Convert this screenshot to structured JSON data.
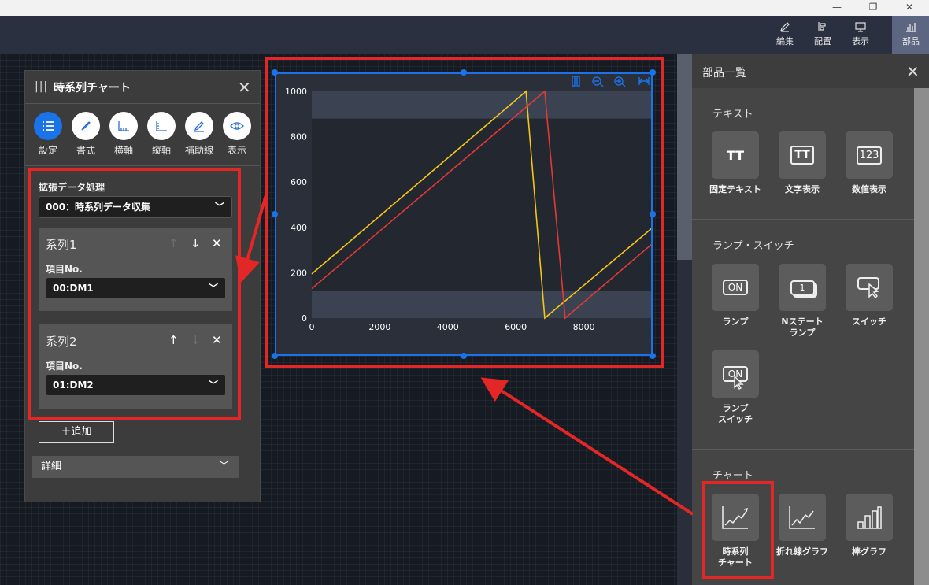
{
  "window": {
    "minimize": "—",
    "restore": "❐",
    "close": "✕"
  },
  "toolbar": {
    "items": [
      {
        "label": "編集",
        "icon": "pencil-icon"
      },
      {
        "label": "配置",
        "icon": "align-icon"
      },
      {
        "label": "表示",
        "icon": "monitor-icon"
      },
      {
        "label": "部品",
        "icon": "parts-chart-icon",
        "active": true
      }
    ]
  },
  "prop_panel": {
    "title": "時系列チャート",
    "drag_glyph": "|||",
    "close": "✕",
    "tabs": [
      {
        "label": "設定",
        "icon": "list-icon",
        "active": true
      },
      {
        "label": "書式",
        "icon": "brush-icon"
      },
      {
        "label": "横軸",
        "icon": "x-axis-icon"
      },
      {
        "label": "縦軸",
        "icon": "y-axis-icon"
      },
      {
        "label": "補助線",
        "icon": "guide-line-icon"
      },
      {
        "label": "表示",
        "icon": "eye-icon"
      }
    ],
    "ext_label": "拡張データ処理",
    "ext_select": "000：時系列データ収集",
    "series": [
      {
        "title": "系列1",
        "item_label": "項目No.",
        "item_value": "00:DM1",
        "up_enabled": false,
        "down_enabled": true
      },
      {
        "title": "系列2",
        "item_label": "項目No.",
        "item_value": "01:DM2",
        "up_enabled": true,
        "down_enabled": false
      }
    ],
    "add_button": "＋追加",
    "detail": "詳細"
  },
  "chart_data": {
    "type": "line",
    "x_ticks": [
      "0",
      "2000",
      "4000",
      "6000",
      "8000"
    ],
    "y_ticks": [
      "0",
      "200",
      "400",
      "600",
      "800",
      "1000"
    ],
    "xlim": [
      0,
      10000
    ],
    "ylim": [
      0,
      1000
    ],
    "bands": [
      {
        "from": 0,
        "to": 120,
        "color": "#3b4252"
      },
      {
        "from": 880,
        "to": 1000,
        "color": "#3b4252"
      }
    ],
    "series": [
      {
        "color": "#f5c518",
        "x": [
          0,
          6300,
          6850,
          9990
        ],
        "y": [
          195,
          1000,
          0,
          395
        ]
      },
      {
        "color": "#e53935",
        "x": [
          0,
          6850,
          7450,
          9990
        ],
        "y": [
          130,
          1000,
          0,
          325
        ]
      }
    ],
    "colors": {
      "background": "#2a2f3a",
      "plot": "#23272f",
      "axis_text": "#ffffff"
    }
  },
  "parts_panel": {
    "title": "部品一覧",
    "close": "✕",
    "groups": [
      {
        "name": "テキスト",
        "items": [
          {
            "label": "固定テキスト",
            "glyph": "TT",
            "icon": "fixed-text-icon"
          },
          {
            "label": "文字表示",
            "glyph": "TT",
            "icon": "text-display-icon"
          },
          {
            "label": "数値表示",
            "glyph": "123",
            "icon": "number-display-icon"
          }
        ]
      },
      {
        "name": "ランプ・スイッチ",
        "items": [
          {
            "label": "ランプ",
            "glyph": "ON",
            "icon": "lamp-icon"
          },
          {
            "label": "Nステート\nランプ",
            "glyph": "1",
            "icon": "n-state-lamp-icon"
          },
          {
            "label": "スイッチ",
            "glyph": "",
            "icon": "switch-icon"
          },
          {
            "label": "ランプ\nスイッチ",
            "glyph": "ON",
            "icon": "lamp-switch-icon"
          }
        ]
      },
      {
        "name": "チャート",
        "items": [
          {
            "label": "時系列\nチャート",
            "glyph": "",
            "icon": "time-series-chart-icon"
          },
          {
            "label": "折れ線グラフ",
            "glyph": "",
            "icon": "line-graph-icon"
          },
          {
            "label": "棒グラフ",
            "glyph": "",
            "icon": "bar-graph-icon"
          }
        ]
      }
    ]
  },
  "highlight_color": "#e32626"
}
